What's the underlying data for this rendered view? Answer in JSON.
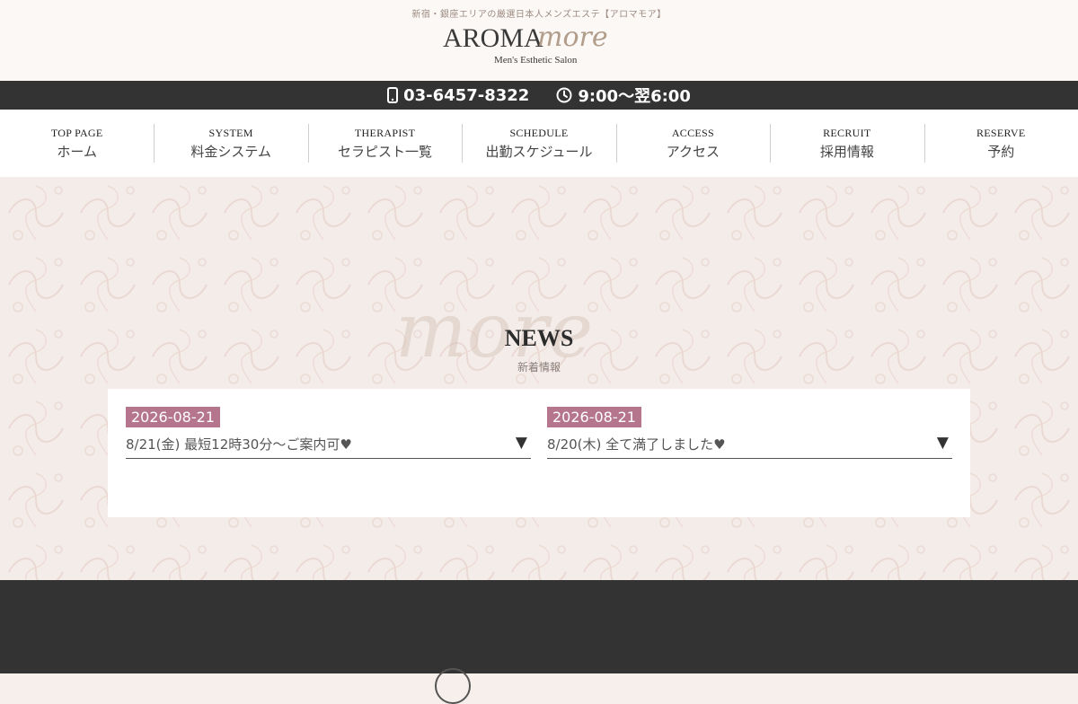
{
  "header": {
    "tagline": "新宿・銀座エリアの厳選日本人メンズエステ【アロマモア】",
    "logo_main": "AROMA",
    "logo_script": "more",
    "logo_sub": "Men's Esthetic Salon"
  },
  "contact": {
    "phone": "03-6457-8322",
    "hours": "9:00〜翌6:00"
  },
  "nav": {
    "items": [
      {
        "en": "TOP PAGE",
        "jp": "ホーム"
      },
      {
        "en": "SYSTEM",
        "jp": "料金システム"
      },
      {
        "en": "THERAPIST",
        "jp": "セラピスト一覧"
      },
      {
        "en": "SCHEDULE",
        "jp": "出勤スケジュール"
      },
      {
        "en": "ACCESS",
        "jp": "アクセス"
      },
      {
        "en": "RECRUIT",
        "jp": "採用情報"
      },
      {
        "en": "RESERVE",
        "jp": "予約"
      }
    ]
  },
  "news": {
    "watermark": "more",
    "title": "NEWS",
    "subtitle": "新着情報",
    "items": [
      {
        "date": "2026-08-21",
        "text": "8/21(金) 最短12時30分〜ご案内可♥",
        "arrow": "▼"
      },
      {
        "date": "2026-08-21",
        "text": "8/20(木) 全て満了しました♥",
        "arrow": "▼"
      }
    ]
  },
  "colors": {
    "dark_bar": "#333333",
    "date_badge": "#b5758d",
    "page_bg": "#f4ece9"
  },
  "icons": [
    "phone-icon",
    "clock-icon",
    "chevron-down-icon"
  ]
}
